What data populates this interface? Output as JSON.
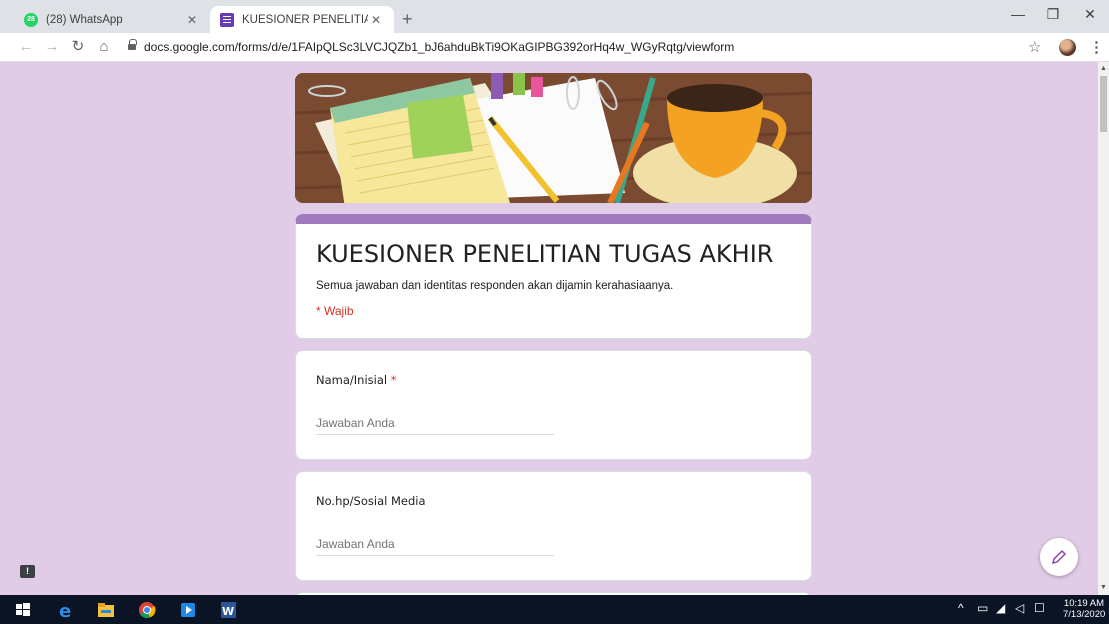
{
  "browser": {
    "tabs": [
      {
        "label": "(28) WhatsApp",
        "badge": "28",
        "active": false
      },
      {
        "label": "KUESIONER PENELITIAN TUGAS",
        "active": true
      }
    ],
    "url": "docs.google.com/forms/d/e/1FAIpQLSc3LVCJQZb1_bJ6ahduBkTi9OKaGIPBG392orHq4w_WGyRqtg/viewform"
  },
  "form": {
    "title": "KUESIONER PENELITIAN TUGAS AKHIR",
    "description": "Semua jawaban dan identitas responden akan dijamin kerahasiaanya.",
    "required_note": "* Wajib",
    "questions": [
      {
        "label": "Nama/Inisial",
        "required_mark": "*",
        "placeholder": "Jawaban Anda"
      },
      {
        "label": "No.hp/Sosial Media",
        "placeholder": "Jawaban Anda"
      }
    ]
  },
  "taskbar": {
    "time": "10:19 AM",
    "date": "7/13/2020"
  },
  "colors": {
    "page_bg": "#e0cce6",
    "accent": "#a27bbf",
    "required": "#d93025"
  }
}
